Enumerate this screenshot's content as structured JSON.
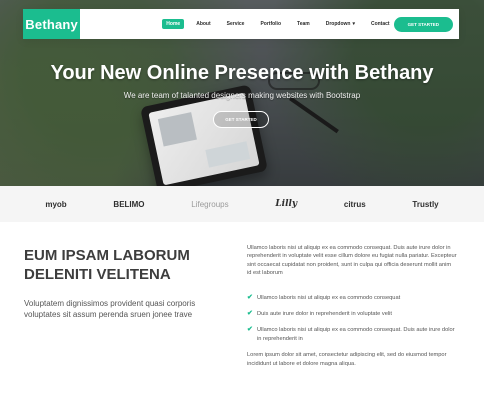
{
  "brand": {
    "name": "Bethany",
    "accent_color": "#1bbd8f"
  },
  "nav": {
    "items": [
      "Home",
      "About",
      "Service",
      "Portfolio",
      "Team",
      "Dropdown",
      "Contact"
    ],
    "dropdown_icon": "chevron-down-icon",
    "cta": "GET STARTED"
  },
  "hero": {
    "title": "Your New Online Presence with Bethany",
    "subtitle": "We are team of talanted designers making websites with Bootstrap",
    "button": "GET STARTED"
  },
  "clients": [
    "myob",
    "BELIMO",
    "Lifegroups",
    "Lilly",
    "citrus",
    "Trustly"
  ],
  "about": {
    "title": "EUM IPSAM LABORUM DELENITI VELITENA",
    "text": "Voluptatem dignissimos provident quasi corporis voluptates sit assum perenda sruen jonee trave",
    "right_intro": "Ullamco laboris nisi ut aliquip ex ea commodo consequat. Duis aute irure dolor in reprehenderit in voluptate velit esse cillum dolore eu fugiat nulla pariatur. Excepteur sint occaecat cupidatat non proident, sunt in culpa qui officia deserunt mollit anim id est laborum",
    "checks": [
      "Ullamco laboris nisi ut aliquip ex ea commodo consequat",
      "Duis aute irure dolor in reprehenderit in voluptate velit",
      "Ullamco laboris nisi ut aliquip ex ea commodo consequat. Duis aute irure dolor in reprehenderit in"
    ],
    "closing": "Lorem ipsum dolor sit amet, consectetur adipiscing elit, sed do eiusmod tempor incididunt ut labore et dolore magna aliqua.",
    "check_icon": "check-icon"
  }
}
